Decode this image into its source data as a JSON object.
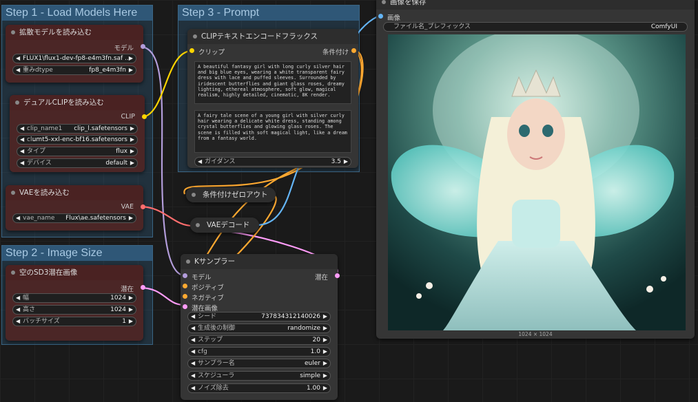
{
  "groups": {
    "step1": "Step 1 - Load Models Here",
    "step2": "Step 2 - Image Size",
    "step3": "Step 3 - Prompt"
  },
  "diffusion_loader": {
    "title": "拡散モデルを読み込む",
    "output": "モデル",
    "unet_name": "FLUX1\\flux1-dev-fp8-e4m3fn.saf ...",
    "dtype_label": "重みdtype",
    "dtype_value": "fp8_e4m3fn"
  },
  "dual_clip": {
    "title": "デュアルCLIPを読み込む",
    "output": "CLIP",
    "clip1_label": "clip_name1",
    "clip1_value": "clip_l.safetensors",
    "clip2_label": "cl...",
    "clip2_value": "umt5-xxl-enc-bf16.safetensors",
    "type_label": "タイプ",
    "type_value": "flux",
    "device_label": "デバイス",
    "device_value": "default"
  },
  "vae_loader": {
    "title": "VAEを読み込む",
    "output": "VAE",
    "name_label": "vae_name",
    "name_value": "Flux\\ae.safetensors"
  },
  "latent": {
    "title": "空のSD3潜在画像",
    "output": "潜在",
    "width_label": "幅",
    "width_value": "1024",
    "height_label": "高さ",
    "height_value": "1024",
    "batch_label": "バッチサイズ",
    "batch_value": "1"
  },
  "clip_encode": {
    "title": "CLIPテキストエンコードフラックス",
    "input": "クリップ",
    "output": "条件付け",
    "clip_l": "A beautiful fantasy girl with long curly silver hair and big blue eyes, wearing a white transparent fairy dress with lace and puffed sleeves. Surrounded by iridescent butterflies and giant glass roses, dreamy lighting, ethereal atmosphere, soft glow, magical realism, highly detailed, cinematic, 8K render.",
    "t5xxl": "A fairy tale scene of a young girl with silver curly hair wearing a delicate white dress, standing among crystal butterflies and glowing glass roses. The scene is filled with soft magical light, like a dream from a fantasy world.",
    "guidance_label": "ガイダンス",
    "guidance_value": "3.5"
  },
  "zero_out": {
    "title": "条件付けゼロアウト"
  },
  "vae_decode": {
    "title": "VAEデコード"
  },
  "ksampler": {
    "title": "Kサンプラー",
    "inputs": [
      "モデル",
      "ポジティブ",
      "ネガティブ",
      "潜在画像"
    ],
    "output": "潜在",
    "widgets": [
      {
        "label": "シード",
        "value": "737834312140026"
      },
      {
        "label": "生成後の制御",
        "value": "randomize"
      },
      {
        "label": "ステップ",
        "value": "20"
      },
      {
        "label": "cfg",
        "value": "1.0"
      },
      {
        "label": "サンプラー名",
        "value": "euler"
      },
      {
        "label": "スケジューラ",
        "value": "simple"
      },
      {
        "label": "ノイズ除去",
        "value": "1.00"
      }
    ]
  },
  "save_image": {
    "title": "画像を保存",
    "input": "画像",
    "prefix_label": "ファイル名_プレフィックス",
    "prefix_value": "ComfyUI",
    "dimensions": "1024 × 1024"
  },
  "colors": {
    "model": "#b39ddb",
    "clip": "#ffd500",
    "vae": "#ff6e6e",
    "latent": "#ff9cf9",
    "cond": "#ffa931",
    "image": "#64b5f6"
  }
}
